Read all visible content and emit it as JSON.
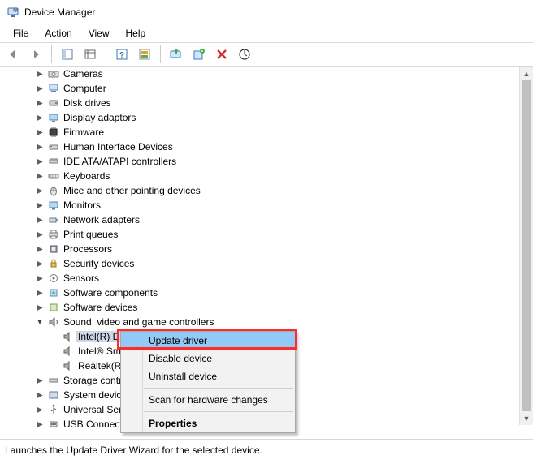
{
  "window": {
    "title": "Device Manager"
  },
  "menu": {
    "file": "File",
    "action": "Action",
    "view": "View",
    "help": "Help"
  },
  "tree": {
    "items": [
      {
        "label": "Cameras"
      },
      {
        "label": "Computer"
      },
      {
        "label": "Disk drives"
      },
      {
        "label": "Display adaptors"
      },
      {
        "label": "Firmware"
      },
      {
        "label": "Human Interface Devices"
      },
      {
        "label": "IDE ATA/ATAPI controllers"
      },
      {
        "label": "Keyboards"
      },
      {
        "label": "Mice and other pointing devices"
      },
      {
        "label": "Monitors"
      },
      {
        "label": "Network adapters"
      },
      {
        "label": "Print queues"
      },
      {
        "label": "Processors"
      },
      {
        "label": "Security devices"
      },
      {
        "label": "Sensors"
      },
      {
        "label": "Software components"
      },
      {
        "label": "Software devices"
      }
    ],
    "expanded": {
      "label": "Sound, video and game controllers",
      "children": [
        {
          "label": "Intel(R) Display Audio"
        },
        {
          "label": "Intel® Sm"
        },
        {
          "label": "Realtek(R)"
        }
      ]
    },
    "after": [
      {
        "label": "Storage contr"
      },
      {
        "label": "System device"
      },
      {
        "label": "Universal Seri"
      },
      {
        "label": "USB Connecto"
      }
    ]
  },
  "context_menu": {
    "update": "Update driver",
    "disable": "Disable device",
    "uninstall": "Uninstall device",
    "scan": "Scan for hardware changes",
    "properties": "Properties"
  },
  "status": {
    "text": "Launches the Update Driver Wizard for the selected device."
  }
}
